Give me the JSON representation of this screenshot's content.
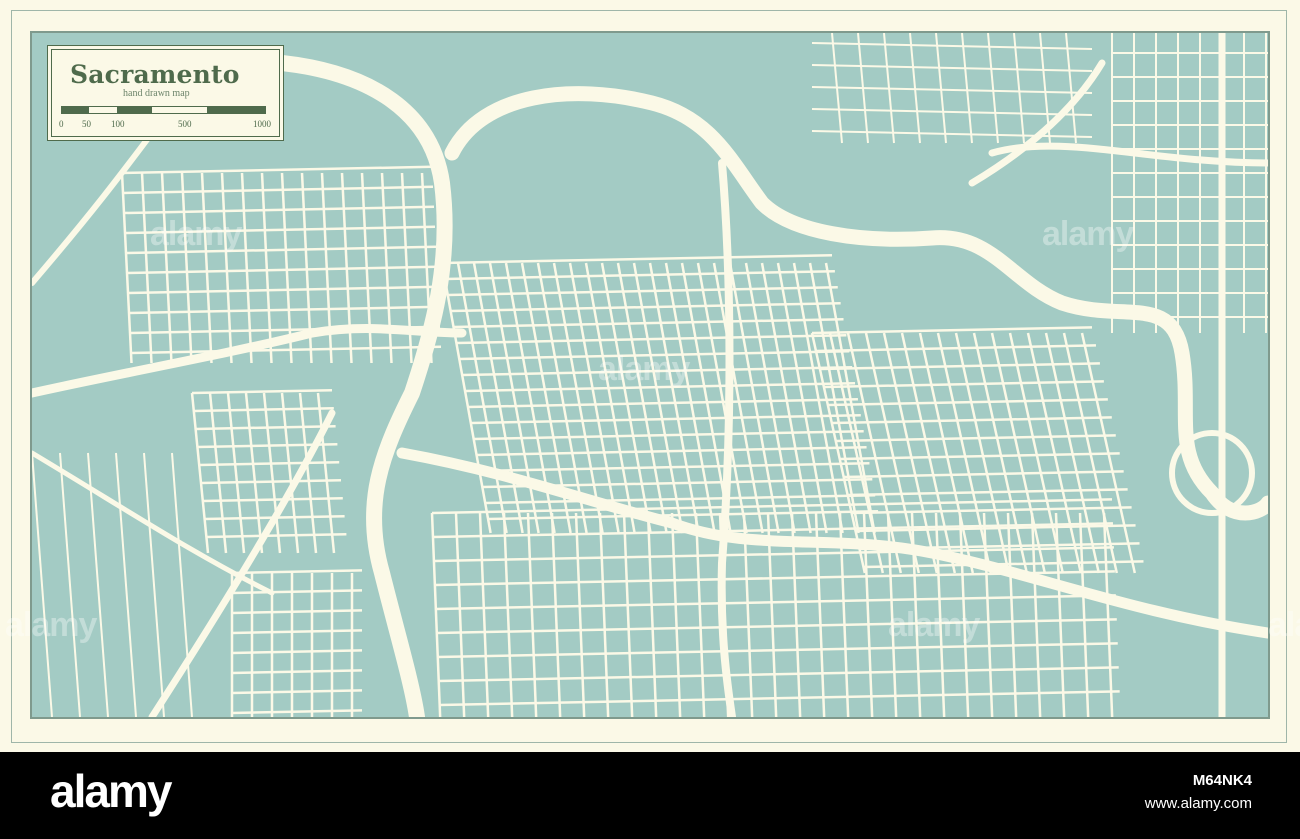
{
  "map": {
    "title": "Sacramento",
    "subtitle": "hand drawn map",
    "scale_ticks": [
      "0",
      "50",
      "100",
      "500",
      "1000"
    ],
    "colors": {
      "water_land": "#a3cbc4",
      "roads": "#fbf9e7",
      "frame": "#4f6b4c",
      "paper": "#fbf9e7"
    }
  },
  "watermarks": [
    "alamy",
    "alamy",
    "alamy",
    "alamy",
    "alamy",
    "alamy"
  ],
  "footer": {
    "logo": "alamy",
    "image_id": "M64NK4",
    "url": "www.alamy.com"
  }
}
